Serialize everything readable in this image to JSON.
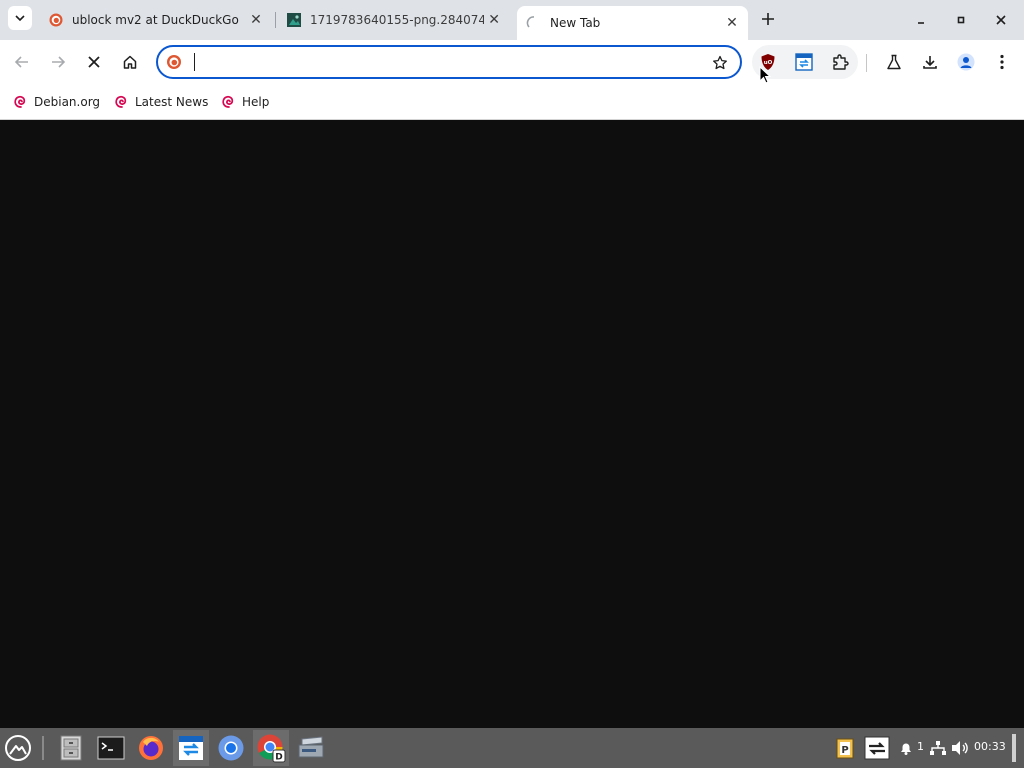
{
  "tabs": [
    {
      "title": "ublock mv2 at DuckDuckGo",
      "favicon": "duckduckgo-icon"
    },
    {
      "title": "1719783640155-png.284074",
      "favicon": "image-file-icon"
    },
    {
      "title": "New Tab",
      "favicon": "loading-spinner-icon",
      "active": true
    }
  ],
  "toolbar": {
    "omnibox_value": "",
    "omnibox_icon": "duckduckgo-icon"
  },
  "bookmarks": [
    {
      "label": "Debian.org"
    },
    {
      "label": "Latest News"
    },
    {
      "label": "Help"
    }
  ],
  "tray": {
    "notification_count": "1",
    "clock": "00:33"
  },
  "colors": {
    "accent": "#0b57d0",
    "content_bg": "#0e0e0e",
    "taskbar_bg": "#5a5a5a",
    "tabstrip_bg": "#dfe3e7"
  }
}
